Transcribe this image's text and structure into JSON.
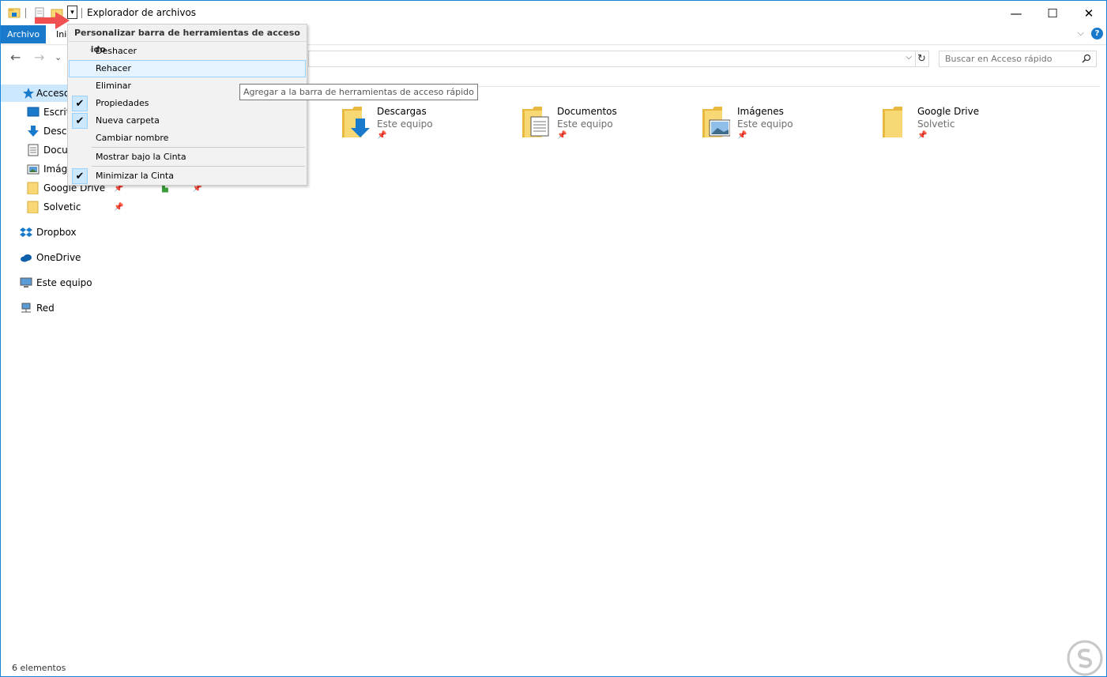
{
  "window": {
    "title": "Explorador de archivos"
  },
  "window_controls": {
    "minimize": "—",
    "maximize": "☐",
    "close": "✕"
  },
  "ribbon": {
    "tab_archivo": "Archivo",
    "tab_inicio": "Ini",
    "expand_glyph": "⌵",
    "help_glyph": "?"
  },
  "nav": {
    "back": "←",
    "forward": "→",
    "recent": "⌄",
    "address_chevron": "⌵",
    "refresh": "↻"
  },
  "search": {
    "placeholder": "Buscar en Acceso rápido"
  },
  "menu": {
    "header": "Personalizar barra de herramientas de acceso rápido",
    "items": [
      {
        "label": "Deshacer",
        "checked": false
      },
      {
        "label": "Rehacer",
        "checked": false,
        "hover": true
      },
      {
        "label": "Eliminar",
        "checked": false
      },
      {
        "label": "Propiedades",
        "checked": true
      },
      {
        "label": "Nueva carpeta",
        "checked": true
      },
      {
        "label": "Cambiar nombre",
        "checked": false
      },
      {
        "label": "Mostrar bajo la Cinta",
        "checked": false
      },
      {
        "label": "Minimizar la Cinta",
        "checked": true
      }
    ],
    "check_glyph": "✔"
  },
  "tooltip": "Agregar a la barra de herramientas de acceso rápido",
  "navpane": {
    "items": [
      {
        "label": "Acceso",
        "icon": "star-icon"
      },
      {
        "label": "Escrit",
        "icon": "desktop-icon"
      },
      {
        "label": "Desca",
        "icon": "download-icon"
      },
      {
        "label": "Docu",
        "icon": "document-icon"
      },
      {
        "label": "Imáge",
        "icon": "picture-icon"
      },
      {
        "label": "Google Drive",
        "icon": "folder-icon"
      },
      {
        "label": "Solvetic",
        "icon": "folder-icon"
      },
      {
        "label": "Dropbox",
        "icon": "dropbox-icon"
      },
      {
        "label": "OneDrive",
        "icon": "onedrive-icon"
      },
      {
        "label": "Este equipo",
        "icon": "computer-icon"
      },
      {
        "label": "Red",
        "icon": "network-icon"
      }
    ],
    "pin_glyph": "📌"
  },
  "tiles": [
    {
      "name": "Descargas",
      "sub": "Este equipo",
      "icon": "download-folder-icon"
    },
    {
      "name": "Documentos",
      "sub": "Este equipo",
      "icon": "documents-folder-icon"
    },
    {
      "name": "Imágenes",
      "sub": "Este equipo",
      "icon": "pictures-folder-icon"
    },
    {
      "name": "Google Drive",
      "sub": "Solvetic",
      "icon": "folder-icon"
    }
  ],
  "status": {
    "count": "6 elementos"
  },
  "colors": {
    "accent": "#1979ca",
    "selection": "#cce8ff",
    "arrow": "#f0504f",
    "folder": "#f8d775"
  }
}
